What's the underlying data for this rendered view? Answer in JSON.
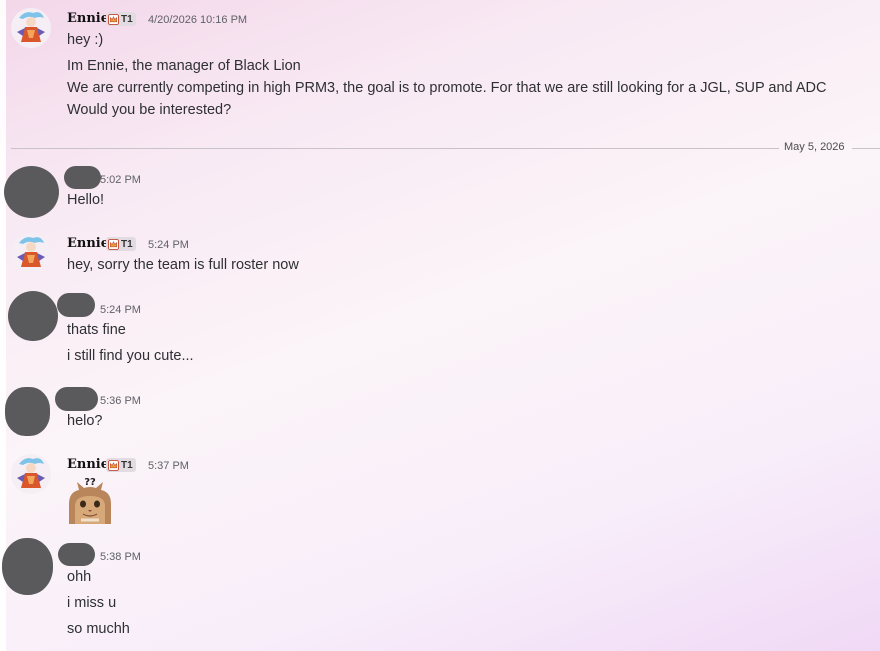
{
  "users": {
    "ennie": "Ennie",
    "tag_label": "T1"
  },
  "messages": [
    {
      "author": "Ennie",
      "time": "4/20/2026 10:16 PM",
      "lines": [
        "hey :)",
        "Im Ennie, the manager of Black Lion",
        "We are currently competing in high PRM3, the goal is to promote. For that we are still looking for a JGL, SUP and ADC",
        "Would you be interested?"
      ]
    },
    {
      "author": "",
      "time": "5:02 PM",
      "lines": [
        "Hello!"
      ]
    },
    {
      "author": "Ennie",
      "time": "5:24 PM",
      "lines": [
        "hey, sorry the team is full roster now"
      ]
    },
    {
      "author": "",
      "time": "5:24 PM",
      "lines": [
        "thats fine",
        "i still find you cute..."
      ]
    },
    {
      "author": "",
      "time": "5:36 PM",
      "lines": [
        "helo?"
      ]
    },
    {
      "author": "Ennie",
      "time": "5:37 PM",
      "lines": [],
      "sticker": "confused-cat-sticker"
    },
    {
      "author": "",
      "time": "5:38 PM",
      "lines": [
        "ohh",
        "i miss u",
        "so muchh"
      ]
    }
  ],
  "divider": {
    "date": "May 5, 2026"
  },
  "icons": {
    "tag": "crown-icon",
    "avatar": "anime-character-avatar",
    "sticker": "cat-icon"
  },
  "colors": {
    "redaction": "#5a5a5c",
    "text": "#2e3035",
    "timestamp": "#5f6168"
  }
}
